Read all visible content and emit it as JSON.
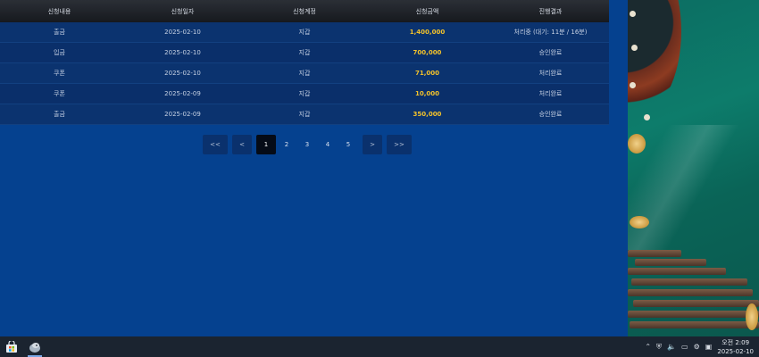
{
  "table": {
    "headers": [
      "신청내용",
      "신청일자",
      "신청계정",
      "신청금액",
      "진행결과"
    ],
    "rows": [
      {
        "type": "출금",
        "date": "2025-02-10",
        "account": "지갑",
        "amount": "1,400,000",
        "status": "처리중 (대기: 11분 / 16분)"
      },
      {
        "type": "입금",
        "date": "2025-02-10",
        "account": "지갑",
        "amount": "700,000",
        "status": "승인완료"
      },
      {
        "type": "쿠폰",
        "date": "2025-02-10",
        "account": "지갑",
        "amount": "71,000",
        "status": "처리완료"
      },
      {
        "type": "쿠폰",
        "date": "2025-02-09",
        "account": "지갑",
        "amount": "10,000",
        "status": "처리완료"
      },
      {
        "type": "출금",
        "date": "2025-02-09",
        "account": "지갑",
        "amount": "350,000",
        "status": "승인완료"
      }
    ]
  },
  "pagination": {
    "first": "<<",
    "prev": "<",
    "pages": [
      "1",
      "2",
      "3",
      "4",
      "5"
    ],
    "active": "1",
    "next": ">",
    "last": ">>"
  },
  "taskbar": {
    "time": "오전 2:09",
    "date": "2025-02-10",
    "icons": [
      "store-icon",
      "app-icon",
      "chevron-up-icon",
      "shield-icon",
      "speaker-icon",
      "monitor-icon",
      "gear-icon",
      "ime-icon"
    ]
  },
  "colors": {
    "page_bg": "#05418f",
    "amount": "#f3c22b",
    "active_page": "#050b17"
  }
}
